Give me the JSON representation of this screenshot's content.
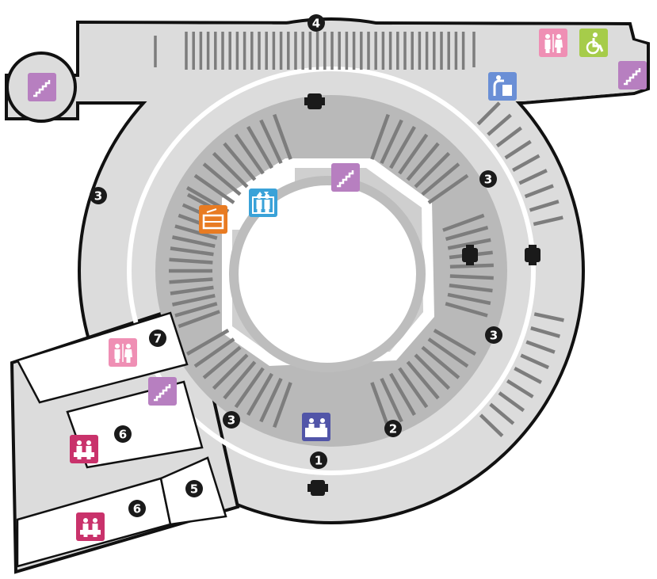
{
  "title": "",
  "colors": {
    "background": "#ffffff",
    "floor": "#dcdcdc",
    "outline": "#111111",
    "aisle": "#ffffff",
    "inner_ring": "#b9b9b9",
    "seats": "#7d7d7d",
    "marker": "#1a1a1a",
    "stairs": "#b77fc0",
    "restroom": "#ef8fb4",
    "accessible": "#a6cc4a",
    "drinking_fountain": "#6a8fd6",
    "elevator": "#3aa2d8",
    "info_desk": "#5155a8",
    "locker": "#e87b22",
    "room": "#c9326b"
  },
  "area_markers": [
    "4",
    "3",
    "3",
    "3",
    "3",
    "2",
    "1",
    "5",
    "6",
    "6",
    "7"
  ],
  "icons": [
    "restroom-icon",
    "accessible-restroom-icon",
    "stairs-icon",
    "stairs-icon",
    "stairs-icon",
    "stairs-icon",
    "drinking-fountain-icon",
    "elevator-icon",
    "coin-locker-icon",
    "information-desk-icon",
    "restroom-icon",
    "meeting-room-icon",
    "meeting-room-icon"
  ]
}
